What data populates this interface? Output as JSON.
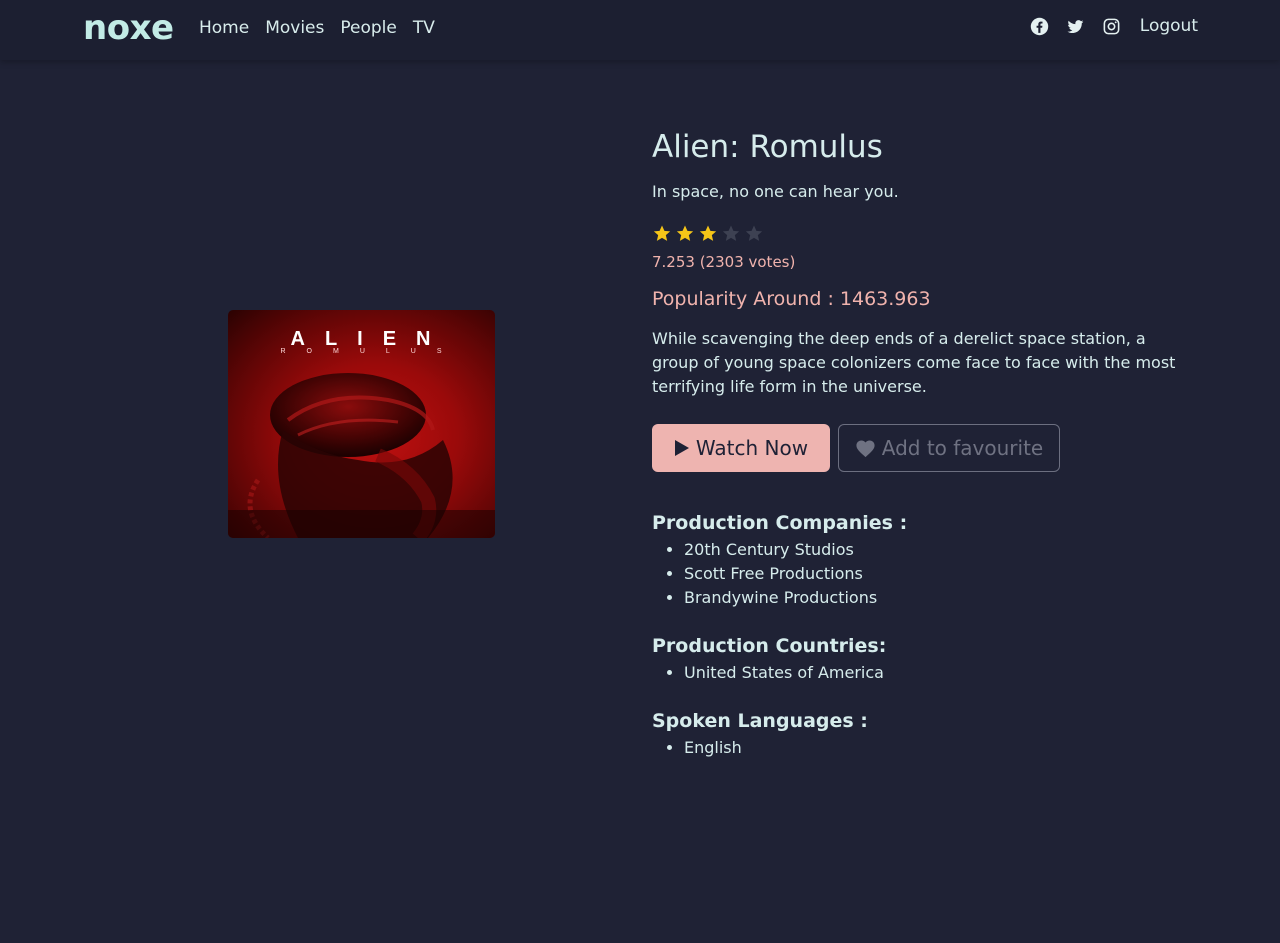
{
  "nav": {
    "brand": "noxe",
    "links": [
      "Home",
      "Movies",
      "People",
      "TV"
    ],
    "social_icons": [
      "facebook-icon",
      "twitter-icon",
      "instagram-icon"
    ],
    "logout": "Logout"
  },
  "movie": {
    "poster_title": "ALIEN",
    "poster_subtitle": "ROMULUS",
    "title": "Alien: Romulus",
    "tagline": "In space, no one can hear you.",
    "stars": {
      "filled": 3,
      "total": 5
    },
    "rating": "7.253 (2303 votes)",
    "popularity_label": "Popularity Around :",
    "popularity_value": "1463.963",
    "overview": "While scavenging the deep ends of a derelict space station, a group of young space colonizers come face to face with the most terrifying life form in the universe.",
    "watch_label": "Watch Now",
    "favourite_label": "Add to favourite",
    "companies_title": "Production Companies :",
    "companies": [
      "20th Century Studios",
      "Scott Free Productions",
      "Brandywine Productions"
    ],
    "countries_title": "Production Countries:",
    "countries": [
      "United States of America"
    ],
    "languages_title": "Spoken Languages :",
    "languages": [
      "English"
    ]
  },
  "colors": {
    "background": "#1f2235",
    "navbar": "#1c1f31",
    "accent": "#eeb4b0",
    "text": "#d6ecec",
    "star_filled": "#f5c518",
    "star_empty": "#3d4152"
  }
}
